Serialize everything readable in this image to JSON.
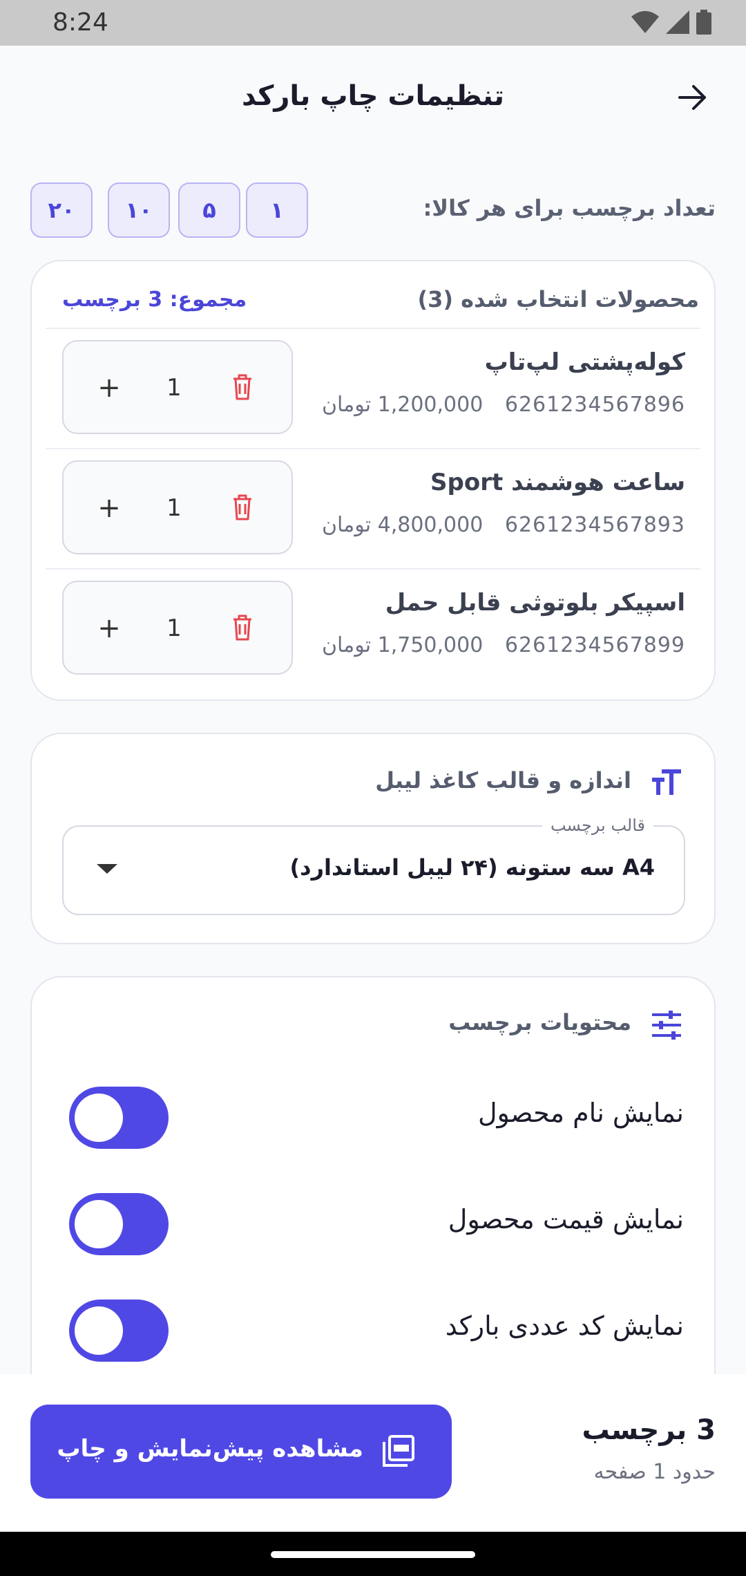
{
  "status_bar": {
    "time": "8:24"
  },
  "header": {
    "title": "تنظیمات چاپ بارکد"
  },
  "quantity": {
    "label": "تعداد برچسب برای هر کالا:",
    "options": [
      "۱",
      "۵",
      "۱۰",
      "۲۰"
    ]
  },
  "products": {
    "title": "محصولات انتخاب شده (3)",
    "total": "مجموع: 3 برچسب",
    "items": [
      {
        "name": "کوله‌پشتی لپ‌تاپ",
        "code": "6261234567896",
        "price": "1,200,000 تومان",
        "qty": "1"
      },
      {
        "name": "ساعت هوشمند Sport",
        "code": "6261234567893",
        "price": "4,800,000 تومان",
        "qty": "1"
      },
      {
        "name": "اسپیکر بلوتوثی قابل حمل",
        "code": "6261234567899",
        "price": "1,750,000 تومان",
        "qty": "1"
      }
    ]
  },
  "paper": {
    "title": "اندازه و قالب کاغذ لیبل",
    "select_label": "قالب برچسب",
    "select_value": "A4 سه ستونه (۲۴ لیبل استاندارد)"
  },
  "content": {
    "title": "محتویات برچسب",
    "toggles": [
      {
        "label": "نمایش نام محصول",
        "on": true
      },
      {
        "label": "نمایش قیمت محصول",
        "on": true
      },
      {
        "label": "نمایش کد عددی بارکد",
        "on": true
      }
    ]
  },
  "bottom": {
    "count": "3 برچسب",
    "pages": "حدود 1 صفحه",
    "button_label": "مشاهده پیش‌نمایش و چاپ"
  },
  "colors": {
    "accent": "#5048e5",
    "delete": "#e5484d",
    "chip_bg": "#ececfd"
  }
}
